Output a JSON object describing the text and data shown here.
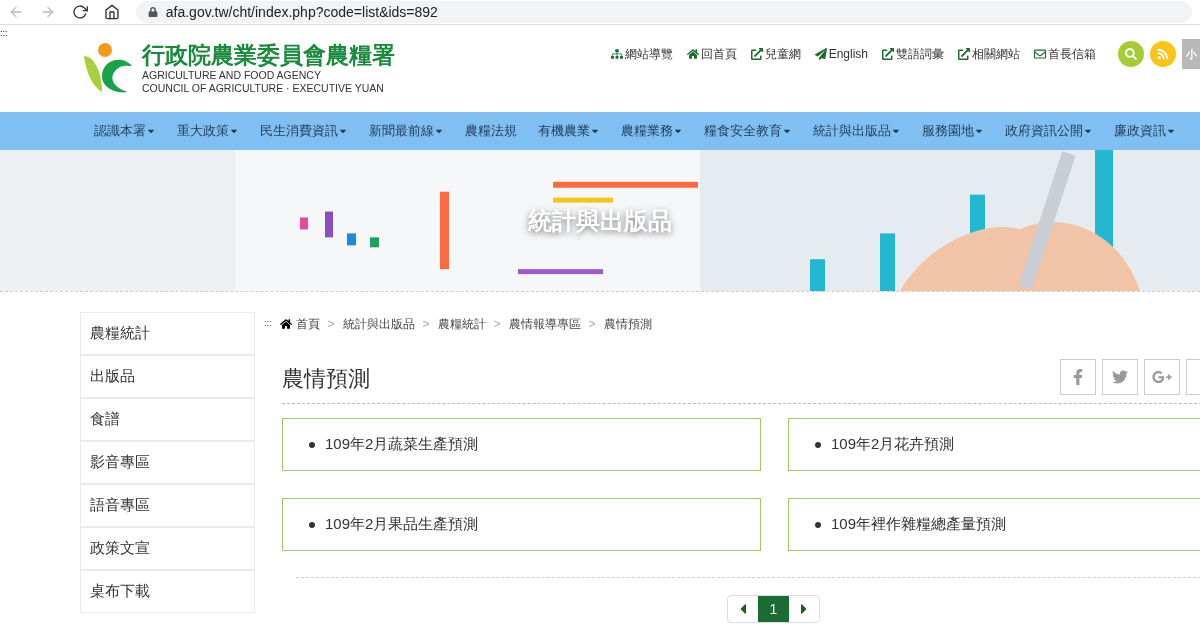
{
  "browser": {
    "url": "afa.gov.tw/cht/index.php?code=list&ids=892"
  },
  "skip_marker": ":::",
  "header": {
    "title": "行政院農業委員會農糧署",
    "subtitle_lines": [
      "AGRICULTURE AND FOOD AGENCY",
      "COUNCIL OF AGRICULTURE · EXECUTIVE YUAN"
    ],
    "links": [
      {
        "label": "網站導覽",
        "kind": "sitemap"
      },
      {
        "label": "回首頁",
        "kind": "home"
      },
      {
        "label": "兒童網",
        "kind": "external"
      },
      {
        "label": "English",
        "kind": "plane"
      },
      {
        "label": "雙語詞彙",
        "kind": "external"
      },
      {
        "label": "相關網站",
        "kind": "external"
      },
      {
        "label": "首長信箱",
        "kind": "mail"
      }
    ],
    "font_size_button": "小"
  },
  "nav": [
    {
      "label": "認識本署",
      "dropdown": true
    },
    {
      "label": "重大政策",
      "dropdown": true
    },
    {
      "label": "民生消費資訊",
      "dropdown": true
    },
    {
      "label": "新聞最前線",
      "dropdown": true
    },
    {
      "label": "農糧法規",
      "dropdown": false
    },
    {
      "label": "有機農業",
      "dropdown": true
    },
    {
      "label": "農糧業務",
      "dropdown": true
    },
    {
      "label": "糧食安全教育",
      "dropdown": true
    },
    {
      "label": "統計與出版品",
      "dropdown": true
    },
    {
      "label": "服務園地",
      "dropdown": true
    },
    {
      "label": "政府資訊公開",
      "dropdown": true
    },
    {
      "label": "廉政資訊",
      "dropdown": true
    }
  ],
  "banner": {
    "kind": "picture",
    "title": "統計與出版品"
  },
  "sidebar": {
    "items": [
      "農糧統計",
      "出版品",
      "食譜",
      "影音專區",
      "語音專區",
      "政策文宣",
      "桌布下載"
    ]
  },
  "breadcrumb": {
    "marker": ":::",
    "separator": ">",
    "items": [
      "首頁",
      "統計與出版品",
      "農糧統計",
      "農情報導專區",
      "農情預測"
    ]
  },
  "page_title": "農情預測",
  "cards": [
    "109年2月蔬菜生產預測",
    "109年2月花卉預測",
    "109年2月果品生產預測",
    "109年裡作雜糧總產量預測"
  ],
  "pagination": {
    "pages": [
      {
        "label": "1",
        "selected": true
      }
    ]
  }
}
